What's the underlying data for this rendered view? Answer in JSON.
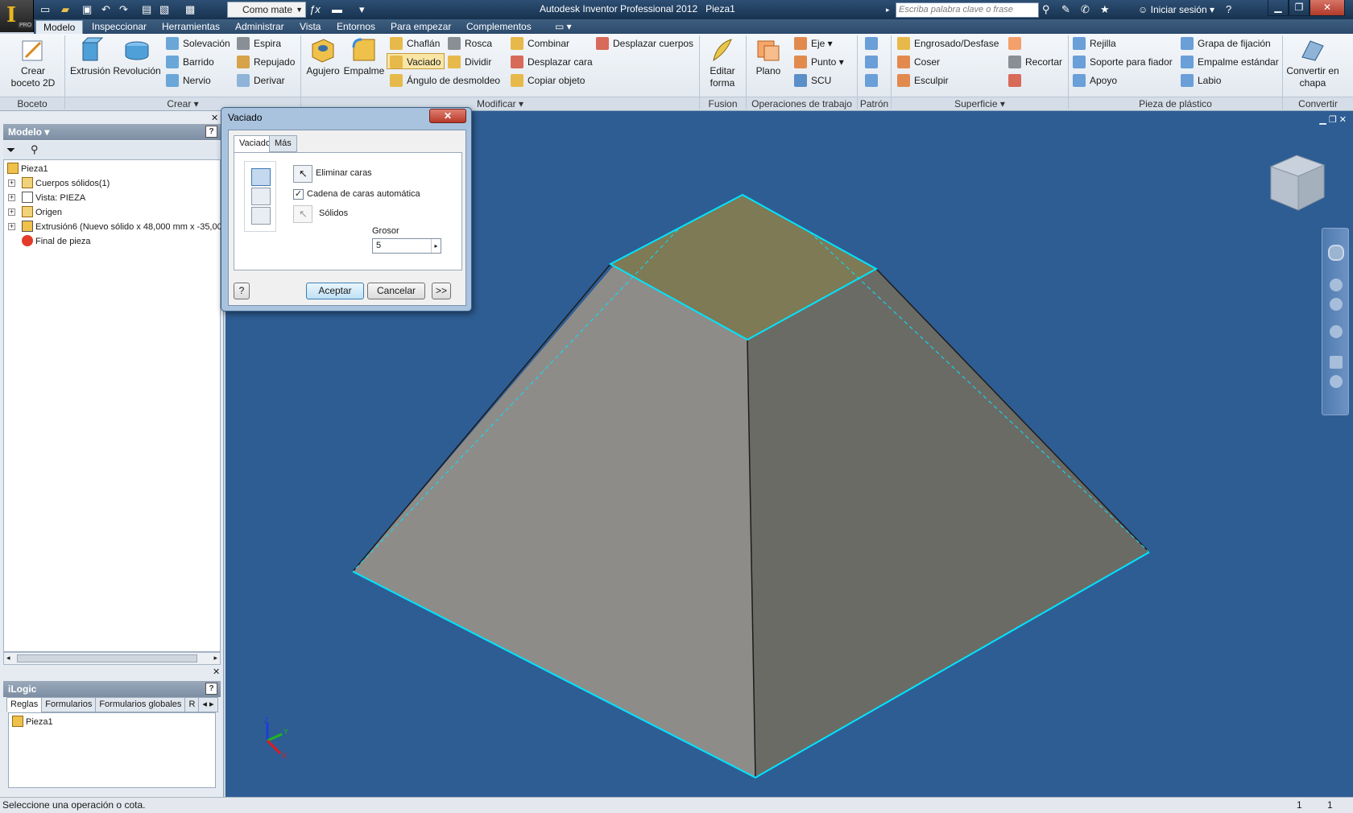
{
  "titlebar": {
    "app_title": "Autodesk Inventor Professional 2012",
    "document": "Pieza1",
    "search_placeholder": "Escriba palabra clave o frase",
    "login": "Iniciar sesión",
    "qat_combo": "Como mate",
    "app_logo": "I",
    "app_badge": "PRO"
  },
  "tabs": [
    "Modelo",
    "Inspeccionar",
    "Herramientas",
    "Administrar",
    "Vista",
    "Entornos",
    "Para empezar",
    "Complementos"
  ],
  "ribbon": {
    "boceto": {
      "label": "Boceto",
      "crear_boceto": "Crear boceto 2D"
    },
    "crear": {
      "label": "Crear",
      "extrusion": "Extrusión",
      "revolucion": "Revolución",
      "solevacion": "Solevación",
      "barrido": "Barrido",
      "nervio": "Nervio",
      "espira": "Espira",
      "repujado": "Repujado",
      "derivar": "Derivar"
    },
    "modificar": {
      "label": "Modificar",
      "agujero": "Agujero",
      "empalme": "Empalme",
      "chaflan": "Chaflán",
      "vaciado": "Vaciado",
      "angulo": "Ángulo de desmoldeo",
      "rosca": "Rosca",
      "dividir": "Dividir",
      "combinar": "Combinar",
      "desplazar_cara": "Desplazar cara",
      "copiar_objeto": "Copiar objeto",
      "desplazar_cuerpos": "Desplazar cuerpos"
    },
    "fusion": {
      "label": "Fusion",
      "editar_forma": "Editar forma"
    },
    "operaciones": {
      "label": "Operaciones de trabajo",
      "plano": "Plano",
      "eje": "Eje",
      "punto": "Punto",
      "scu": "SCU"
    },
    "patron": {
      "label": "Patrón"
    },
    "superficie": {
      "label": "Superficie",
      "engrosado": "Engrosado/Desfase",
      "coser": "Coser",
      "esculpir": "Esculpir",
      "recortar": "Recortar"
    },
    "plastico": {
      "label": "Pieza de plástico",
      "rejilla": "Rejilla",
      "soporte": "Soporte para fiador",
      "apoyo": "Apoyo",
      "grapa": "Grapa de fijación",
      "empalme_estandar": "Empalme estándar",
      "labio": "Labio"
    },
    "convertir": {
      "label": "Convertir",
      "convertir_chapa": "Convertir en chapa"
    }
  },
  "browser": {
    "title": "Modelo",
    "tree": [
      {
        "label": "Pieza1",
        "icon": "part-icon"
      },
      {
        "label": "Cuerpos sólidos(1)",
        "icon": "folder-icon"
      },
      {
        "label": "Vista: PIEZA",
        "icon": "view-icon"
      },
      {
        "label": "Origen",
        "icon": "folder-icon"
      },
      {
        "label": "Extrusión6 (Nuevo sólido x 48,000 mm x -35,00",
        "icon": "extrusion-icon"
      },
      {
        "label": "Final de pieza",
        "icon": "end-of-part-icon"
      }
    ]
  },
  "ilogic": {
    "title": "iLogic",
    "tabs": [
      "Reglas",
      "Formularios",
      "Formularios globales",
      "R"
    ],
    "item": "Pieza1"
  },
  "dialog": {
    "title": "Vaciado",
    "tabs": [
      "Vaciado",
      "Más"
    ],
    "eliminar_caras": "Eliminar caras",
    "cadena": "Cadena de caras automática",
    "cadena_checked": true,
    "solidos": "Sólidos",
    "grosor_label": "Grosor",
    "grosor_value": "5",
    "aceptar": "Aceptar",
    "cancelar": "Cancelar",
    "more": ">>",
    "help": "?"
  },
  "status": {
    "message": "Seleccione una operación o cota.",
    "count1": "1",
    "count2": "1"
  },
  "colors": {
    "viewport_bg": "#2e5d94",
    "edge_highlight": "#00e5ff",
    "selected_face": "#7d7a55"
  }
}
